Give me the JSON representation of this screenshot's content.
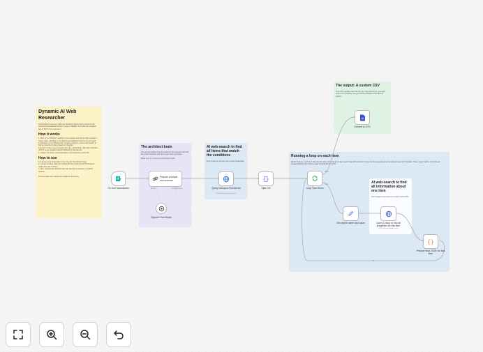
{
  "main_note": {
    "title": "Dynamic AI Web Researcher",
    "intro": "This workflow turns any plain-text research request into a custom-built, structured spreadsheet (CSV). It uses a \"Builder\" AI to plan the research and a \"Doer\" AI to execute it.",
    "how_title": "How it works",
    "how_items": [
      "1. Plan: An AI \"Planner\" analyzes your request and dynamically creates a custom plan, deciding on the perfect spreadsheet columns for your goal.",
      "2. Discover: An AI \"Researcher\" (Linkup) performs a deep web search to find an initial list of items based on the plan.",
      "3. Enrich: It then loops through each item, performing a fast web searches to fill in all the detailed columns defined by the planner.",
      "4. Output: The final, structured data is converted into a CSV file."
    ],
    "use_title": "How to use",
    "use_items": [
      "1. Connect your AI provider to the OpenAI Chat Model node.",
      "2. Connect Linkup: Add your Linkup API key to the two HTTP Request nodes that use a Linkup.",
      "3. Run: Activate the workflow and use the form to submit a research request."
    ],
    "credit": "This template was created by Guillaume Duvernay"
  },
  "architect_note": {
    "title": "The architect brain",
    "body": "This AI step defines how the output of the research will look like (CSV schema), and how to get there (prompts).",
    "body2": "Make sure to connect a powerful AI model."
  },
  "search_note": {
    "title": "AI web-search to find all items that match the conditions",
    "body": "Don't forget to connect your Linkup credentials."
  },
  "output_note": {
    "title": "The output: A custom CSV",
    "body": "This CSV contains one row per item that was found, and each column is a property that got enriched thanks to the Web AI search."
  },
  "loop_note": {
    "title": "Running a loop on each item",
    "body": "Within this loop, each item from the list will go through an AI web search that will find all the values for the properties that the other AI step has identified. These values will be cleaned and prepared before the outcome gets converted into a CSV."
  },
  "enrich_note": {
    "title": "AI web-search to find all information about one item",
    "body": "Don't forget to connect your Linkup credentials."
  },
  "nodes": {
    "form": {
      "label": "On form submission"
    },
    "prepare": {
      "label": "Prepare prompts and schema"
    },
    "openai": {
      "label": "OpenAI Chat Model"
    },
    "query_list": {
      "label": "Query Linkup to find the list",
      "sub": "POST: https://api.linkup.so/v1"
    },
    "split": {
      "label": "Split Out"
    },
    "loop": {
      "label": "Loop Over Items"
    },
    "set_object": {
      "label": "Set object name and value"
    },
    "query_item": {
      "label": "Query Linkup to find all properties for this item",
      "sub": "POST: https://api.linkup.so/v1"
    },
    "prepare_json": {
      "label": "Prepare final JSON for that item"
    },
    "csv": {
      "label": "Convert to CSV"
    }
  },
  "port_labels": {
    "model": "Model",
    "output_parser": "Output Parser",
    "done": "done",
    "loop": "loop"
  },
  "controls": {
    "fit": "fit-view",
    "zoom_in": "zoom-in",
    "zoom_out": "zoom-out",
    "undo": "undo"
  },
  "colors": {
    "yellow": "#fdf1c7",
    "purple": "#e6e4f7",
    "blue": "#dde8f5",
    "green": "#dff3e4",
    "accent": "#ff6d5a"
  }
}
